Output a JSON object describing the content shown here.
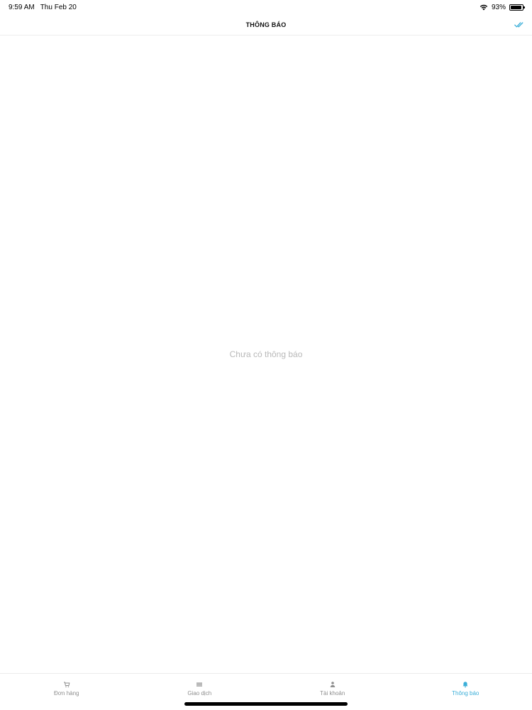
{
  "status_bar": {
    "time": "9:59 AM",
    "date": "Thu Feb 20",
    "battery": "93%",
    "battery_level": 0.93
  },
  "nav": {
    "title": "THÔNG BÁO",
    "action_icon": "double-check-icon"
  },
  "content": {
    "empty_message": "Chưa có thông báo"
  },
  "tabs": [
    {
      "label": "Đơn hàng",
      "icon": "cart-icon",
      "active": false
    },
    {
      "label": "Giao dịch",
      "icon": "list-icon",
      "active": false
    },
    {
      "label": "Tài khoản",
      "icon": "person-icon",
      "active": false
    },
    {
      "label": "Thông báo",
      "icon": "bell-icon",
      "active": true
    }
  ],
  "colors": {
    "accent": "#3aaed8",
    "inactive": "#8e8e8e",
    "empty_text": "#b9b9b9"
  }
}
